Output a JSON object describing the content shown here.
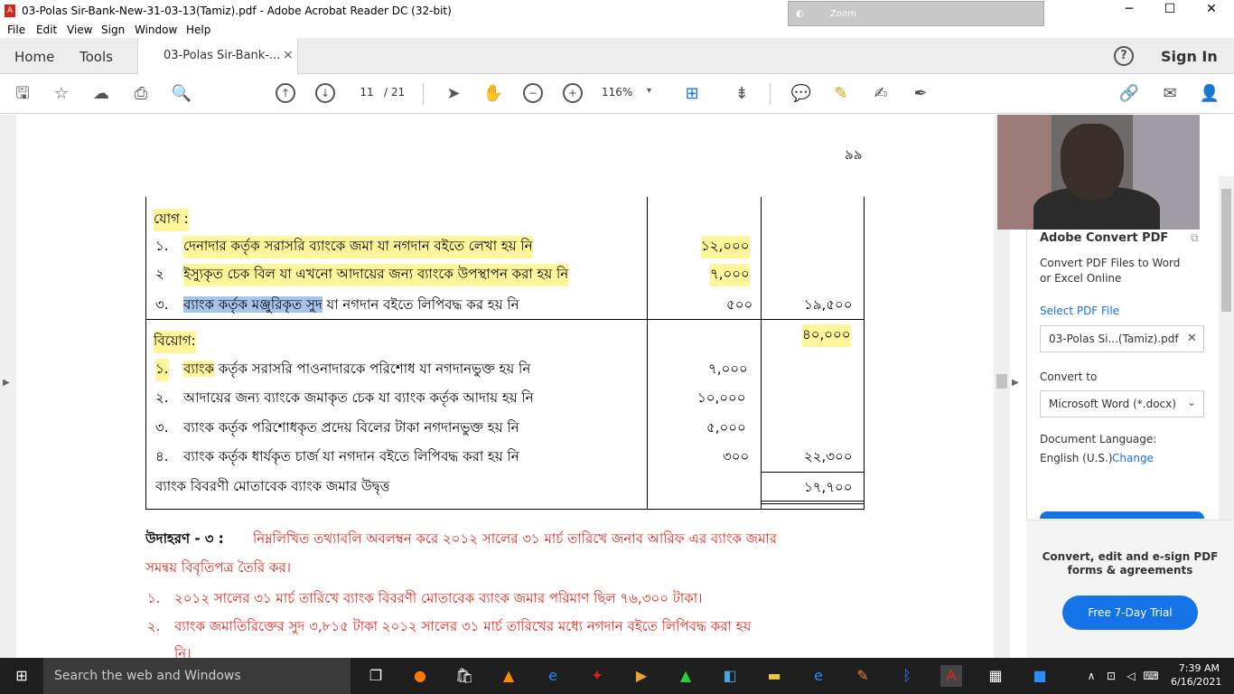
{
  "window": {
    "title": "03-Polas Sir-Bank-New-31-03-13(Tamiz).pdf - Adobe Acrobat Reader DC (32-bit)",
    "minimize": "─",
    "maximize": "☐",
    "close": "✕"
  },
  "overlay": {
    "label": "Zoom",
    "ico": "◐"
  },
  "menu": {
    "file": "File",
    "edit": "Edit",
    "view": "View",
    "sign": "Sign",
    "window": "Window",
    "help": "Help"
  },
  "tabs": {
    "home": "Home",
    "tools": "Tools",
    "doc": "03-Polas Sir-Bank-...",
    "close": "×",
    "help": "?",
    "signin": "Sign In"
  },
  "toolbar": {
    "page_current": "11",
    "page_total": "/ 21",
    "zoom": "116%",
    "caret": "▾"
  },
  "doc": {
    "page_number": "৯৯",
    "add_heading": "যোগ :",
    "add_items": [
      {
        "no": "১.",
        "text": "দেনাদার কর্তৃক সরাসরি ব্যাংকে জমা  যা নগদান বইতে লেখা হয় নি",
        "amt": "১২,০০০"
      },
      {
        "no": "২",
        "text": "ইস্যুকৃত চেক বিল যা এখনো আদায়ের জন্য ব্যাংকে উপস্থাপন করা হয় নি",
        "amt": "৭,০০০"
      },
      {
        "no": "৩.",
        "text_sel": "ব্যাংক কর্তৃক মঞ্জুরিকৃত সুদ",
        "text": " যা নগদান বইতে লিপিবদ্ধ কর হয় নি",
        "amt": "৫০০",
        "total": "১৯,৫০০"
      }
    ],
    "subtotal": "৪০,০০০",
    "less_heading": "বিয়োগ:",
    "less_items": [
      {
        "no": "১.",
        "text_hl": "ব্যাংক",
        "text": " কর্তৃক সরাসরি পাওনাদারকে পরিশোধ যা নগদানভুক্ত হয় নি",
        "amt": "৭,০০০"
      },
      {
        "no": "২.",
        "text": "আদায়ের জন্য ব্যাংকে জমাকৃত চেক যা ব্যাংক কর্তৃক আদায়  হয় নি",
        "amt": "১০,০০০"
      },
      {
        "no": "৩.",
        "text": "ব্যাংক কর্তৃক পরিশোধকৃত প্রদেয় বিলের টাকা নগদানভুক্ত হয় নি",
        "amt": "৫,০০০"
      },
      {
        "no": "৪.",
        "text": "ব্যাংক কর্তৃক ধার্যকৃত চার্জ যা নগদান বইতে লিপিবদ্ধ করা হয় নি",
        "amt": "৩০০",
        "total": "২২,৩০০"
      }
    ],
    "balance_label": "ব্যাংক বিবরণী মোতাবেক ব্যাংক জমার উদ্বৃত্ত",
    "balance": "১৭,৭০০",
    "example_label": "উদাহরণ - ৩ :",
    "example_line1": "নিম্নলিখিত তথ্যাবলি অবলম্বন করে ২০১২ সালের ৩১ মার্চ তারিখে জনাব আরিফ এর ব্যাংক জমার",
    "example_line2": "সমন্বয় বিবৃতিপত্র তৈরি কর।",
    "ex_items": [
      {
        "no": "১.",
        "text": "২০১২ সালের ৩১ মার্চ তারিখে ব্যাংক বিবরণী মোতাবেক ব্যাংক জমার পরিমাণ ছিল ৭৬,৩০০ টাকা।"
      },
      {
        "no": "২.",
        "text": "ব্যাংক জমাতিরিক্তের সুদ ৩,৮১৫ টাকা ২০১২ সালের ৩১ মার্চ তারিখের মধ্যে নগদান বইতে লিপিবদ্ধ করা হয়",
        "cont": "নি।"
      }
    ]
  },
  "pane": {
    "title": "Adobe Convert PDF",
    "desc1": "Convert PDF Files to Word",
    "desc2": "or Excel Online",
    "select": "Select PDF File",
    "file": "03-Polas Si...(Tamiz).pdf",
    "file_x": "✕",
    "convert_to": "Convert to",
    "format": "Microsoft Word (*.docx)",
    "format_caret": "⌄",
    "lang_label": "Document Language:",
    "lang": "English (U.S.)",
    "change": "Change",
    "promo1": "Convert, edit and e-sign PDF",
    "promo2": "forms & agreements",
    "trial": "Free 7-Day Trial"
  },
  "taskbar": {
    "search": "Search the web and Windows",
    "time": "7:39 AM",
    "date": "6/16/2021"
  },
  "colors": {
    "highlight": "#fff59a",
    "selection": "#a7c5ec",
    "red_text": "#e0231c",
    "accent": "#1473e6"
  }
}
